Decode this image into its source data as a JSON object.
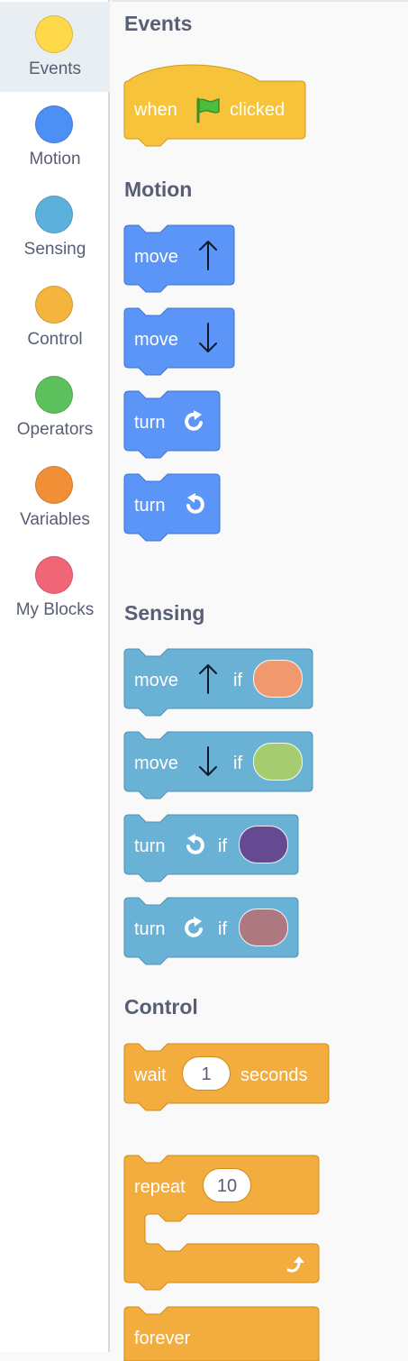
{
  "categories": [
    {
      "label": "Events",
      "color": "#ffd94a"
    },
    {
      "label": "Motion",
      "color": "#4c8ff5"
    },
    {
      "label": "Sensing",
      "color": "#5cb1dc"
    },
    {
      "label": "Control",
      "color": "#f4b43d"
    },
    {
      "label": "Operators",
      "color": "#5cc15c"
    },
    {
      "label": "Variables",
      "color": "#f08f35"
    },
    {
      "label": "My Blocks",
      "color": "#f06676"
    }
  ],
  "sections": {
    "events": "Events",
    "motion": "Motion",
    "sensing": "Sensing",
    "control": "Control"
  },
  "blocks": {
    "when_flag": {
      "word1": "when",
      "word2": "clicked",
      "icon": "green-flag-icon"
    },
    "move_up": {
      "label": "move",
      "icon": "arrow-up-icon"
    },
    "move_down": {
      "label": "move",
      "icon": "arrow-down-icon"
    },
    "turn_right": {
      "label": "turn",
      "icon": "rotate-right-icon"
    },
    "turn_left": {
      "label": "turn",
      "icon": "rotate-left-icon"
    },
    "sense_move_up": {
      "label": "move",
      "if": "if",
      "slot_color": "#f0986e"
    },
    "sense_move_down": {
      "label": "move",
      "if": "if",
      "slot_color": "#a7cc6f"
    },
    "sense_turn_left": {
      "label": "turn",
      "if": "if",
      "slot_color": "#654a91"
    },
    "sense_turn_right": {
      "label": "turn",
      "if": "if",
      "slot_color": "#ad7880"
    },
    "wait": {
      "label": "wait",
      "value": "1",
      "unit": "seconds"
    },
    "repeat": {
      "label": "repeat",
      "value": "10"
    },
    "forever": {
      "label": "forever"
    }
  },
  "colors": {
    "events": "#f7c33b",
    "motion": "#5b95f7",
    "sensing": "#6ab1d6",
    "control": "#f3ad3f"
  }
}
